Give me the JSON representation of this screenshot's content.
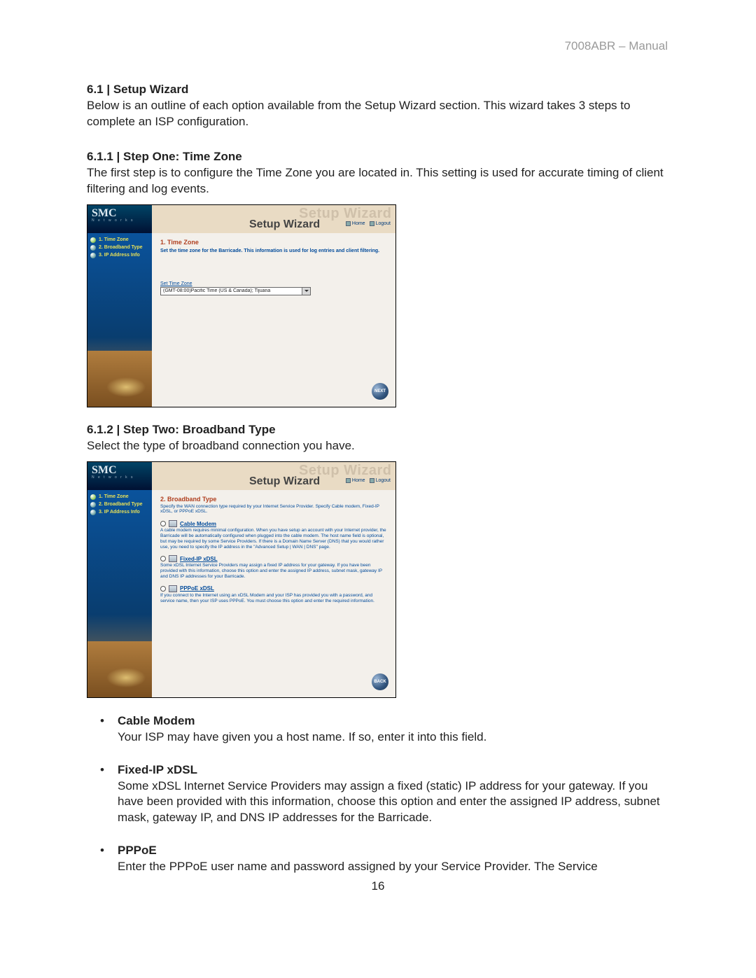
{
  "header": {
    "doc_label": "7008ABR – Manual"
  },
  "section": {
    "num_title": "6.1 | Setup Wizard",
    "intro": "Below is an outline of each option available from the Setup Wizard section. This wizard takes 3 steps to complete an ISP configuration."
  },
  "step1": {
    "num_title": "6.1.1 | Step One: Time Zone",
    "body": "The first step is to configure the Time Zone you are located in. This setting is used for accurate timing of client filtering and log events."
  },
  "step2": {
    "num_title": "6.1.2 | Step Two: Broadband Type",
    "body": "Select the type of broadband connection you have."
  },
  "screenshot_common": {
    "logo_main": "SMC",
    "logo_sub": "N e t w o r k s",
    "ghost_title": "Setup Wizard",
    "wizard_title": "Setup Wizard",
    "home": "Home",
    "logout": "Logout",
    "sidebar": {
      "items": [
        {
          "label": "1. Time Zone"
        },
        {
          "label": "2. Broadband Type"
        },
        {
          "label": "3. IP Address Info"
        }
      ]
    }
  },
  "shot1": {
    "title": "1. Time Zone",
    "desc": "Set the time zone for the Barricade. This information is used for log entries and client filtering.",
    "field_label": "Set Time Zone",
    "dropdown_value": "(GMT-08:00)Pacific Time (US & Canada); Tijuana",
    "next": "NEXT"
  },
  "shot2": {
    "title": "2. Broadband Type",
    "desc": "Specify the WAN connection type required by your Internet Service Provider. Specify Cable modem, Fixed-IP xDSL, or PPPoE xDSL.",
    "options": [
      {
        "link": "Cable Modem",
        "text": "A cable modem requires minimal configuration. When you have setup an account with your Internet provider, the Barricade will be automatically configured when plugged into the cable modem. The host name field is optional, but may be required by some Service Providers. If there is a Domain Name Server (DNS) that you would rather use, you need to specify the IP address in the \"Advanced Setup | WAN | DNS\" page."
      },
      {
        "link": "Fixed-IP xDSL",
        "text": "Some xDSL Internet Service Providers may assign a fixed IP address for your gateway. If you have been provided with this information, choose this option and enter the assigned IP address, subnet mask, gateway IP and DNS IP addresses for your Barricade."
      },
      {
        "link": "PPPoE xDSL",
        "text": "If you connect to the Internet using an xDSL Modem and your ISP has provided you with a password, and service name, then your ISP uses PPPoE. You must choose this option and enter the required information."
      }
    ],
    "back": "BACK"
  },
  "bullets": [
    {
      "title": "Cable Modem",
      "text": "Your ISP may have given you a host name. If so, enter it into this field."
    },
    {
      "title": "Fixed-IP xDSL",
      "text": "Some xDSL Internet Service Providers may assign a fixed (static) IP address for your gateway. If you have been provided with this information, choose this option and enter the assigned IP address, subnet mask, gateway IP, and DNS IP addresses for the Barricade."
    },
    {
      "title": "PPPoE",
      "text": "Enter the PPPoE user name and password assigned by your Service Provider. The Service"
    }
  ],
  "page_number": "16"
}
